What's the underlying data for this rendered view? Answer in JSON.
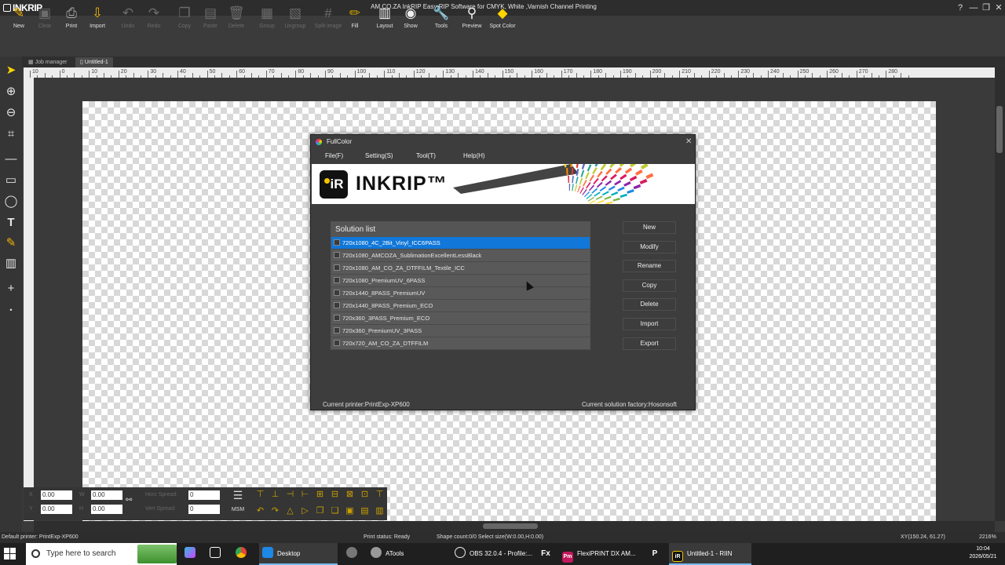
{
  "app": {
    "logo": "INKRIP",
    "window_title": "AM.CO.ZA InkRIP Easy RIP Software for CMYK, White ,Varnish Channel Printing",
    "window_controls": [
      "?",
      "—",
      "❐",
      "✕"
    ]
  },
  "toolbar": {
    "items": [
      {
        "label": "New",
        "icon": "new-icon"
      },
      {
        "label": "Clear",
        "icon": "clear-icon"
      },
      {
        "label": "Print",
        "icon": "print-icon"
      },
      {
        "label": "Import",
        "icon": "import-icon"
      },
      {
        "label": "Undo",
        "icon": "undo-icon"
      },
      {
        "label": "Redo",
        "icon": "redo-icon"
      },
      {
        "label": "Copy",
        "icon": "copy-icon"
      },
      {
        "label": "Paste",
        "icon": "paste-icon"
      },
      {
        "label": "Delete",
        "icon": "delete-icon"
      },
      {
        "label": "Group",
        "icon": "group-icon"
      },
      {
        "label": "Ungroup",
        "icon": "ungroup-icon"
      },
      {
        "label": "Split image",
        "icon": "split-image-icon"
      },
      {
        "label": "Fill",
        "icon": "fill-icon"
      },
      {
        "label": "Layout",
        "icon": "layout-icon"
      },
      {
        "label": "Show",
        "icon": "show-icon"
      },
      {
        "label": "Tools",
        "icon": "tools-icon"
      },
      {
        "label": "Preview",
        "icon": "preview-icon"
      },
      {
        "label": "Spot Color",
        "icon": "spot-color-icon"
      }
    ]
  },
  "tabs": [
    {
      "label": "Job manager"
    },
    {
      "label": "Untitled-1"
    }
  ],
  "ruler": {
    "ticks": [
      "10",
      "0",
      "10",
      "20",
      "30",
      "40",
      "50",
      "60",
      "70",
      "80",
      "90",
      "100",
      "110",
      "120",
      "130",
      "140",
      "150",
      "160",
      "170",
      "180",
      "190",
      "200",
      "210",
      "220",
      "230",
      "240",
      "250",
      "260",
      "270",
      "280"
    ]
  },
  "dialog": {
    "title": "FullColor",
    "menu": [
      "File(F)",
      "Setting(S)",
      "Tool(T)",
      "Help(H)"
    ],
    "banner_logo": "iR",
    "banner_text": "INKRIP™",
    "solution_list_title": "Solution list",
    "solutions": [
      "720x1080_4C_2Bit_Vinyl_ICC6PASS",
      "720x1080_AMCOZA_SublimationExcellentLessBlack",
      "720x1080_AM_CO_ZA_DTFFILM_Textile_ICC",
      "720x1080_PremiumUV_6PASS",
      "720x1440_8PASS_PremiumUV",
      "720x1440_8PASS_Premium_ECO",
      "720x360_3PASS_Premium_ECO",
      "720x360_PremiumUV_3PASS",
      "720x720_AM_CO_ZA_DTFFILM"
    ],
    "selected_index": 0,
    "buttons": [
      "New",
      "Modify",
      "Rename",
      "Copy",
      "Delete",
      "Import",
      "Export"
    ],
    "current_printer": "Current printer:PrintExp-XP600",
    "current_factory": "Current solution factory:Hosonsoft"
  },
  "properties": {
    "x_value": "0.00",
    "y_value": "0.00",
    "w_value": "0.00",
    "h_value": "0.00",
    "horz_spread_label": "Horz Spread:",
    "vert_spread_label": "Vert Spread:",
    "horz_spread_value": "0",
    "vert_spread_value": "0",
    "msm_label": "MSM"
  },
  "status": {
    "default_printer": "Default printer: PrintExp-XP600",
    "print_status": "Print status: Ready",
    "shape_count": "Shape count:0/0  Select size(W:0.00,H:0.00)",
    "coords": "XY(150.24, 61.27)",
    "zoom": "2216%"
  },
  "taskbar": {
    "search_placeholder": "Type here to search",
    "items": [
      {
        "label": "Desktop"
      },
      {
        "label": "ATools"
      },
      {
        "label": "OBS 32.0.4 - Profile:..."
      },
      {
        "label": "FlexiPRINT DX AM..."
      },
      {
        "label": "Untitled-1 - RIIN"
      }
    ],
    "icon_labels": [
      "Fx",
      "P"
    ],
    "time": "10:04",
    "date": "2026/05/21"
  }
}
